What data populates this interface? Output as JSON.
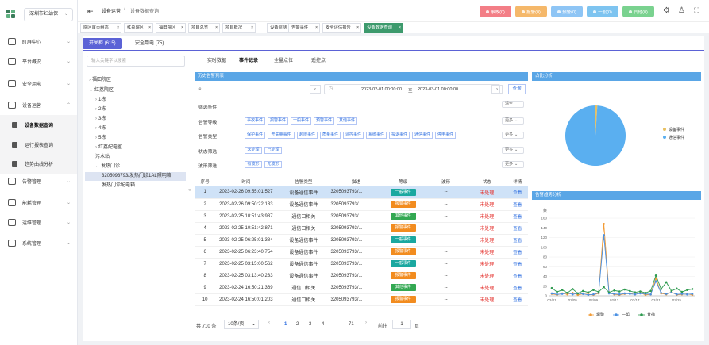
{
  "org_select": "深圳市妇幼保",
  "menu": [
    {
      "label": "盯屏中心",
      "type": "top"
    },
    {
      "label": "平台概况",
      "type": "top"
    },
    {
      "label": "安全用电",
      "type": "top"
    },
    {
      "label": "设备运营",
      "type": "top"
    },
    {
      "label": "设备数据查询",
      "type": "sub",
      "active": true
    },
    {
      "label": "运行报表查询",
      "type": "sub"
    },
    {
      "label": "趋势曲线分析",
      "type": "sub"
    },
    {
      "label": "告警管理",
      "type": "top"
    },
    {
      "label": "能耗管理",
      "type": "top"
    },
    {
      "label": "运维管理",
      "type": "top"
    },
    {
      "label": "系统管理",
      "type": "top"
    }
  ],
  "breadcrumb": [
    "设备运营",
    "设备数据查询"
  ],
  "header_buttons": [
    {
      "label": "事故(0)",
      "color": "#f37e86"
    },
    {
      "label": "报警(0)",
      "color": "#f5b86a"
    },
    {
      "label": "预警(0)",
      "color": "#8ec5f5"
    },
    {
      "label": "一般(0)",
      "color": "#7ec4f0"
    },
    {
      "label": "其他(0)",
      "color": "#7ad28f"
    }
  ],
  "tabs": [
    "院区首页组态",
    "红荔院区",
    "福田院区",
    "项目总览",
    "项目概况",
    "设备监测",
    "告警事件",
    "安全评估报告",
    "设备数据查询"
  ],
  "switch": {
    "a": "开关柜 (615)",
    "b": "安全用电 (75)"
  },
  "tree": {
    "search_placeholder": "输入关键字以搜索",
    "nodes": [
      "福田院区",
      "红荔院区",
      "1栋",
      "2栋",
      "3栋",
      "4栋",
      "5栋",
      "红荔配电室",
      "污水站",
      "发热门诊",
      "3205093793/发热门诊1AL照明箱",
      "发热门诊配电箱"
    ]
  },
  "inner_tabs": [
    "实时数据",
    "事件记录",
    "全量点位",
    "遥控点"
  ],
  "history_title": "历史告警列表",
  "date_range": {
    "start": "2023-02-01 00:00:00",
    "sep": "至",
    "end": "2023-03-01 00:00:00",
    "query": "查询"
  },
  "filters": {
    "title": "筛选条件",
    "clear": "清空",
    "rows": [
      {
        "label": "告警等级",
        "opts": [
          "事故事件",
          "报警事件",
          "一般事件",
          "预警事件",
          "其他事件"
        ]
      },
      {
        "label": "告警类型",
        "opts": [
          "保护事件",
          "开关量事件",
          "越限事件",
          "质量事件",
          "遥控事件",
          "系统事件",
          "投退事件",
          "通信事件",
          "停电事件"
        ]
      },
      {
        "label": "状态筛选",
        "opts": [
          "未处理",
          "已处理"
        ]
      },
      {
        "label": "波形筛选",
        "opts": [
          "有波形",
          "无波形"
        ]
      }
    ],
    "more": "更多"
  },
  "table": {
    "headers": [
      "序号",
      "时间",
      "告警类型",
      "描述",
      "等级",
      "波形",
      "状态",
      "详情"
    ],
    "rows": [
      {
        "no": "1",
        "time": "2023-02-26 09:55:01.527",
        "type": "设备通信事件",
        "desc": "3205093793/...",
        "level": "一般事件",
        "lc": "#1aa8a0",
        "wave": "--",
        "status": "未处理",
        "detail": "查看"
      },
      {
        "no": "2",
        "time": "2023-02-26 09:50:22.133",
        "type": "设备通信事件",
        "desc": "3205093793/...",
        "level": "报警事件",
        "lc": "#f28c1f",
        "wave": "--",
        "status": "未处理",
        "detail": "查看"
      },
      {
        "no": "3",
        "time": "2023-02-25 10:51:43.937",
        "type": "通信口相关",
        "desc": "3205093793/...",
        "level": "其他事件",
        "lc": "#33a852",
        "wave": "--",
        "status": "未处理",
        "detail": "查看"
      },
      {
        "no": "4",
        "time": "2023-02-25 10:51:42.871",
        "type": "通信口相关",
        "desc": "3205093793/...",
        "level": "报警事件",
        "lc": "#f28c1f",
        "wave": "--",
        "status": "未处理",
        "detail": "查看"
      },
      {
        "no": "5",
        "time": "2023-02-25 06:25:01.384",
        "type": "设备通信事件",
        "desc": "3205093793/...",
        "level": "一般事件",
        "lc": "#1aa8a0",
        "wave": "--",
        "status": "未处理",
        "detail": "查看"
      },
      {
        "no": "6",
        "time": "2023-02-25 06:23:40.754",
        "type": "设备通信事件",
        "desc": "3205093793/...",
        "level": "报警事件",
        "lc": "#f28c1f",
        "wave": "--",
        "status": "未处理",
        "detail": "查看"
      },
      {
        "no": "7",
        "time": "2023-02-25 03:15:00.562",
        "type": "设备通信事件",
        "desc": "3205093793/...",
        "level": "一般事件",
        "lc": "#1aa8a0",
        "wave": "--",
        "status": "未处理",
        "detail": "查看"
      },
      {
        "no": "8",
        "time": "2023-02-25 03:13:40.233",
        "type": "设备通信事件",
        "desc": "3205093793/...",
        "level": "报警事件",
        "lc": "#f28c1f",
        "wave": "--",
        "status": "未处理",
        "detail": "查看"
      },
      {
        "no": "9",
        "time": "2023-02-24 16:50:21.369",
        "type": "通信口相关",
        "desc": "3205093793/...",
        "level": "其他事件",
        "lc": "#33a852",
        "wave": "--",
        "status": "未处理",
        "detail": "查看"
      },
      {
        "no": "10",
        "time": "2023-02-24 16:50:01.203",
        "type": "通信口相关",
        "desc": "3205093793/...",
        "level": "报警事件",
        "lc": "#f28c1f",
        "wave": "--",
        "status": "未处理",
        "detail": "查看"
      }
    ]
  },
  "pagination": {
    "total": "共 710 条",
    "size": "10条/页",
    "pages": [
      "1",
      "2",
      "3",
      "4",
      "···",
      "71"
    ],
    "goto": "前往",
    "page": "1",
    "unit": "页"
  },
  "pie_title": "占比分析",
  "trend_title": "告警趋势分析",
  "chart_data": [
    {
      "type": "pie",
      "title": "占比分析",
      "slices": [
        {
          "name": "设备事件",
          "value": 1,
          "color": "#e8c060"
        },
        {
          "name": "通信事件",
          "value": 99,
          "color": "#5aaff0"
        }
      ]
    },
    {
      "type": "line",
      "title": "告警趋势分析",
      "ylabel": "条",
      "ylim": [
        0,
        160
      ],
      "yticks": [
        0,
        20,
        40,
        60,
        80,
        100,
        120,
        140,
        160
      ],
      "x": [
        "02/01",
        "02/03",
        "02/05",
        "02/07",
        "02/09",
        "02/11",
        "02/13",
        "02/15",
        "02/17",
        "02/19",
        "02/21",
        "02/23",
        "02/25",
        "02/27"
      ],
      "xticks": [
        "02/01",
        "02/05",
        "02/09",
        "02/13",
        "02/17",
        "02/21",
        "02/25"
      ],
      "series": [
        {
          "name": "报警",
          "color": "#f29b35",
          "values": [
            4,
            2,
            5,
            3,
            6,
            2,
            4,
            3,
            2,
            5,
            148,
            6,
            3,
            2,
            4,
            5,
            3,
            6,
            2,
            3,
            36,
            5,
            3,
            8,
            2,
            3,
            4,
            2
          ]
        },
        {
          "name": "一般",
          "color": "#4a90e2",
          "values": [
            5,
            3,
            4,
            6,
            3,
            5,
            4,
            2,
            3,
            6,
            125,
            5,
            4,
            3,
            5,
            4,
            3,
            5,
            4,
            3,
            30,
            6,
            4,
            7,
            3,
            4,
            3,
            4
          ]
        },
        {
          "name": "其他",
          "color": "#2d9a4f",
          "values": [
            16,
            8,
            12,
            6,
            14,
            5,
            10,
            7,
            12,
            8,
            18,
            7,
            11,
            9,
            13,
            10,
            7,
            9,
            6,
            10,
            42,
            14,
            28,
            10,
            15,
            8,
            12,
            14
          ]
        }
      ]
    }
  ]
}
